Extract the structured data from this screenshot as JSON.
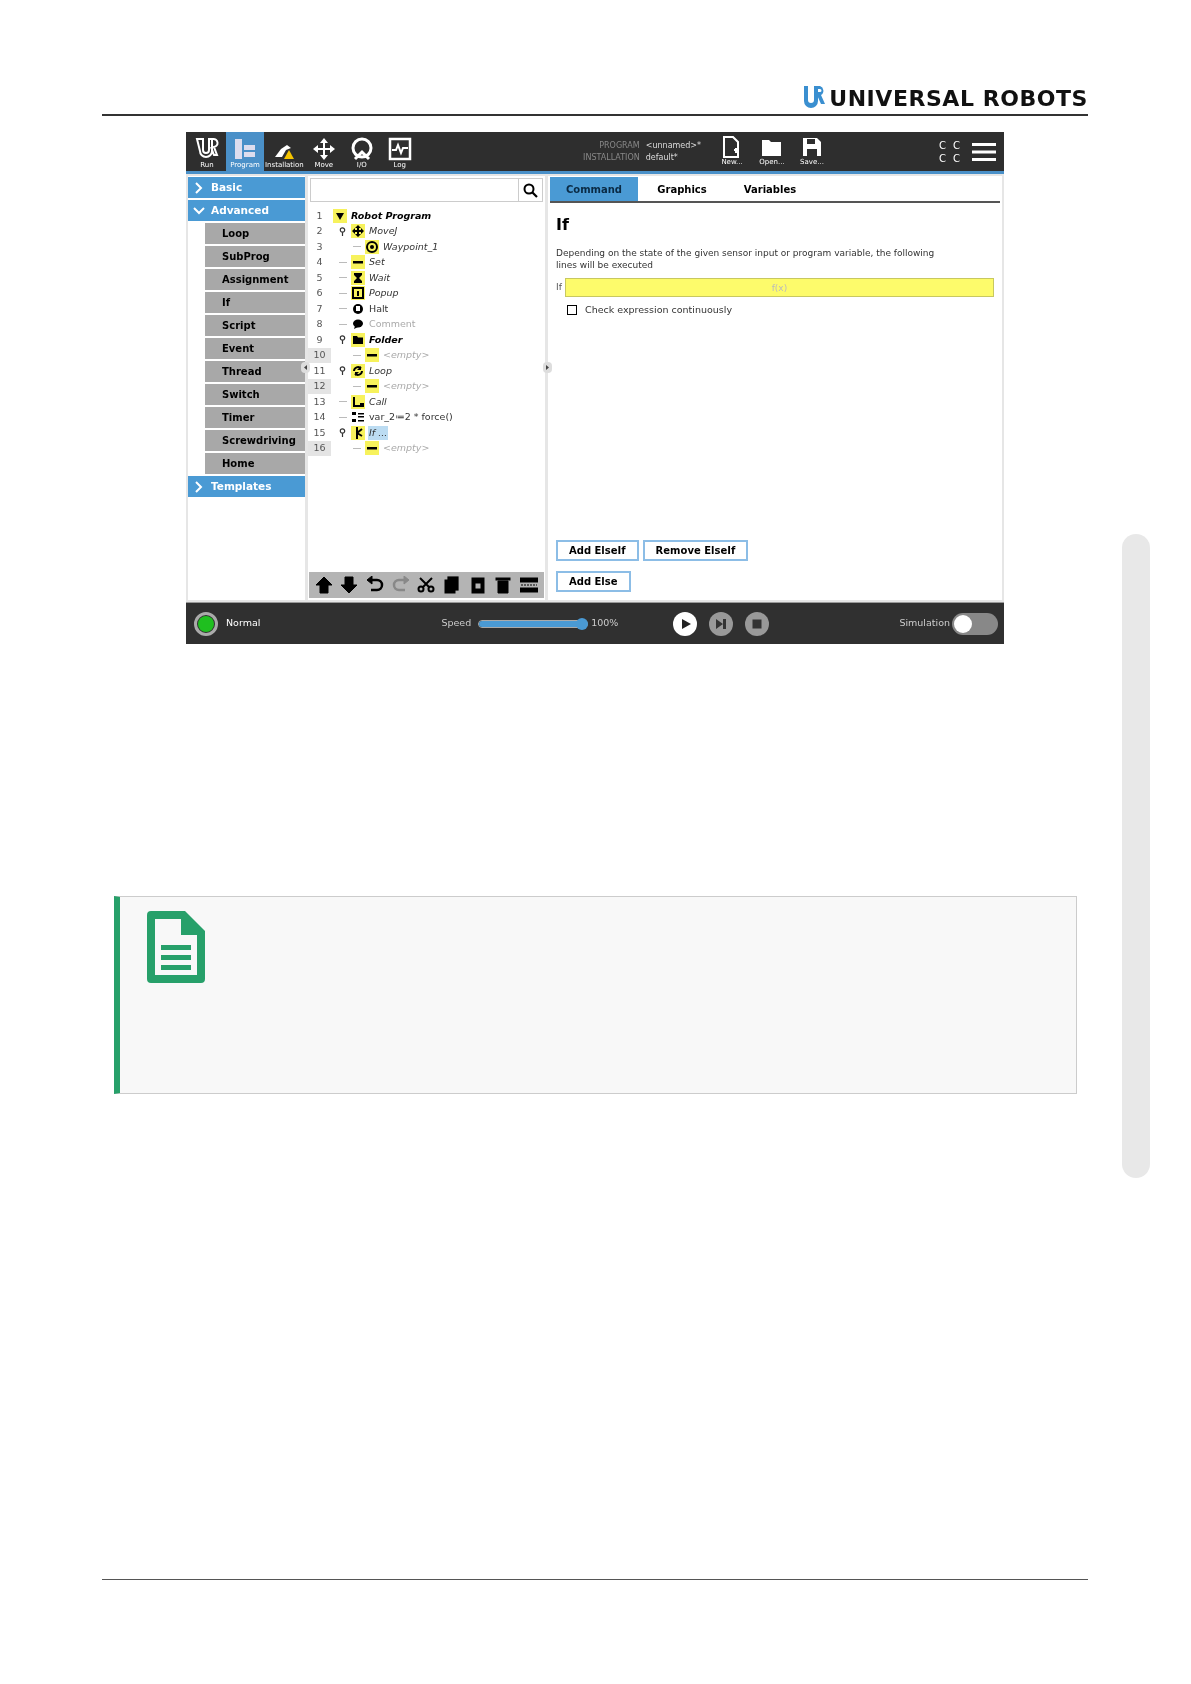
{
  "brand": "UNIVERSAL ROBOTS",
  "screen": {
    "top_tabs": [
      {
        "label": "Run",
        "kind": "run",
        "selected": false
      },
      {
        "label": "Program",
        "kind": "program",
        "selected": true
      },
      {
        "label": "Installation",
        "kind": "installation",
        "selected": false
      },
      {
        "label": "Move",
        "kind": "move",
        "selected": false
      },
      {
        "label": "I/O",
        "kind": "io",
        "selected": false
      },
      {
        "label": "Log",
        "kind": "log",
        "selected": false
      }
    ],
    "program_info": [
      {
        "label": "PROGRAM",
        "value": "<unnamed>*"
      },
      {
        "label": "INSTALLATION",
        "value": "default*"
      }
    ],
    "file_buttons": [
      {
        "label": "New...",
        "kind": "new"
      },
      {
        "label": "Open...",
        "kind": "open"
      },
      {
        "label": "Save...",
        "kind": "save"
      }
    ],
    "indicators": [
      "C",
      "C",
      "C",
      "C"
    ],
    "sidebar": [
      {
        "label": "Basic",
        "expanded": false
      },
      {
        "label": "Advanced",
        "expanded": true,
        "children": [
          "Loop",
          "SubProg",
          "Assignment",
          "If",
          "Script",
          "Event",
          "Thread",
          "Switch",
          "Timer",
          "Screwdriving",
          "Home"
        ]
      },
      {
        "label": "Templates",
        "expanded": false
      }
    ],
    "tree": [
      {
        "number": "1",
        "label": "Robot Program",
        "kind": "root",
        "expanded": true,
        "shaded": false,
        "selected": false,
        "children": [
          {
            "number": "2",
            "label": "MoveJ",
            "kind": "move",
            "expanded": true,
            "shaded": false,
            "selected": false,
            "children": [
              {
                "number": "3",
                "label": "Waypoint_1",
                "kind": "waypoint",
                "expanded": false,
                "shaded": false,
                "selected": false
              }
            ]
          },
          {
            "number": "4",
            "label": "Set",
            "kind": "set",
            "expanded": false,
            "shaded": false,
            "selected": false
          },
          {
            "number": "5",
            "label": "Wait",
            "kind": "wait",
            "expanded": false,
            "shaded": false,
            "selected": false
          },
          {
            "number": "6",
            "label": "Popup",
            "kind": "popup",
            "expanded": false,
            "shaded": false,
            "selected": false
          },
          {
            "number": "7",
            "label": "Halt",
            "kind": "halt",
            "expanded": false,
            "shaded": false,
            "selected": false
          },
          {
            "number": "8",
            "label": "Comment",
            "kind": "comment",
            "expanded": false,
            "shaded": false,
            "selected": false
          },
          {
            "number": "9",
            "label": "Folder",
            "kind": "folder",
            "expanded": true,
            "shaded": false,
            "selected": false,
            "children": [
              {
                "number": "10",
                "label": "<empty>",
                "kind": "empty",
                "expanded": false,
                "shaded": true,
                "selected": false
              }
            ]
          },
          {
            "number": "11",
            "label": "Loop",
            "kind": "loop",
            "expanded": true,
            "shaded": false,
            "selected": false,
            "children": [
              {
                "number": "12",
                "label": "<empty>",
                "kind": "empty",
                "expanded": false,
                "shaded": true,
                "selected": false
              }
            ]
          },
          {
            "number": "13",
            "label": "Call",
            "kind": "call",
            "expanded": false,
            "shaded": false,
            "selected": false
          },
          {
            "number": "14",
            "label": "var_2≔2 * force()",
            "kind": "assignment",
            "expanded": false,
            "shaded": false,
            "selected": false
          },
          {
            "number": "15",
            "label": "If ...",
            "kind": "if",
            "expanded": true,
            "shaded": false,
            "selected": true,
            "children": [
              {
                "number": "16",
                "label": "<empty>",
                "kind": "empty",
                "expanded": false,
                "shaded": true,
                "selected": false
              }
            ]
          }
        ]
      }
    ],
    "tree_toolbar": [
      {
        "kind": "up",
        "disabled": false
      },
      {
        "kind": "down",
        "disabled": false
      },
      {
        "kind": "undo",
        "disabled": false
      },
      {
        "kind": "redo",
        "disabled": true
      },
      {
        "kind": "cut",
        "disabled": false
      },
      {
        "kind": "copy",
        "disabled": false
      },
      {
        "kind": "paste",
        "disabled": false
      },
      {
        "kind": "delete",
        "disabled": false
      },
      {
        "kind": "suppress",
        "disabled": false
      }
    ],
    "tabs": [
      {
        "label": "Command",
        "selected": true
      },
      {
        "label": "Graphics",
        "selected": false
      },
      {
        "label": "Variables",
        "selected": false
      }
    ],
    "node_title": "If",
    "description": "Depending on the state of the given sensor input or program variable, the following lines will be executed",
    "expression": {
      "label": "If",
      "placeholder": "f(x)"
    },
    "check": {
      "label": "Check expression continuously",
      "checked": false
    },
    "buttons": [
      [
        "Add ElseIf",
        "Remove ElseIf"
      ],
      [
        "Add Else"
      ]
    ],
    "status": {
      "label": "Normal",
      "color": "#1fbf1f"
    },
    "speed": {
      "label": "Speed",
      "level": 1.0,
      "reading": "100%"
    },
    "playback": [
      {
        "kind": "play",
        "disabled": false
      },
      {
        "kind": "step",
        "disabled": true
      },
      {
        "kind": "stop",
        "disabled": true
      }
    ],
    "simulation": {
      "label": "Simulation",
      "on": false
    }
  }
}
